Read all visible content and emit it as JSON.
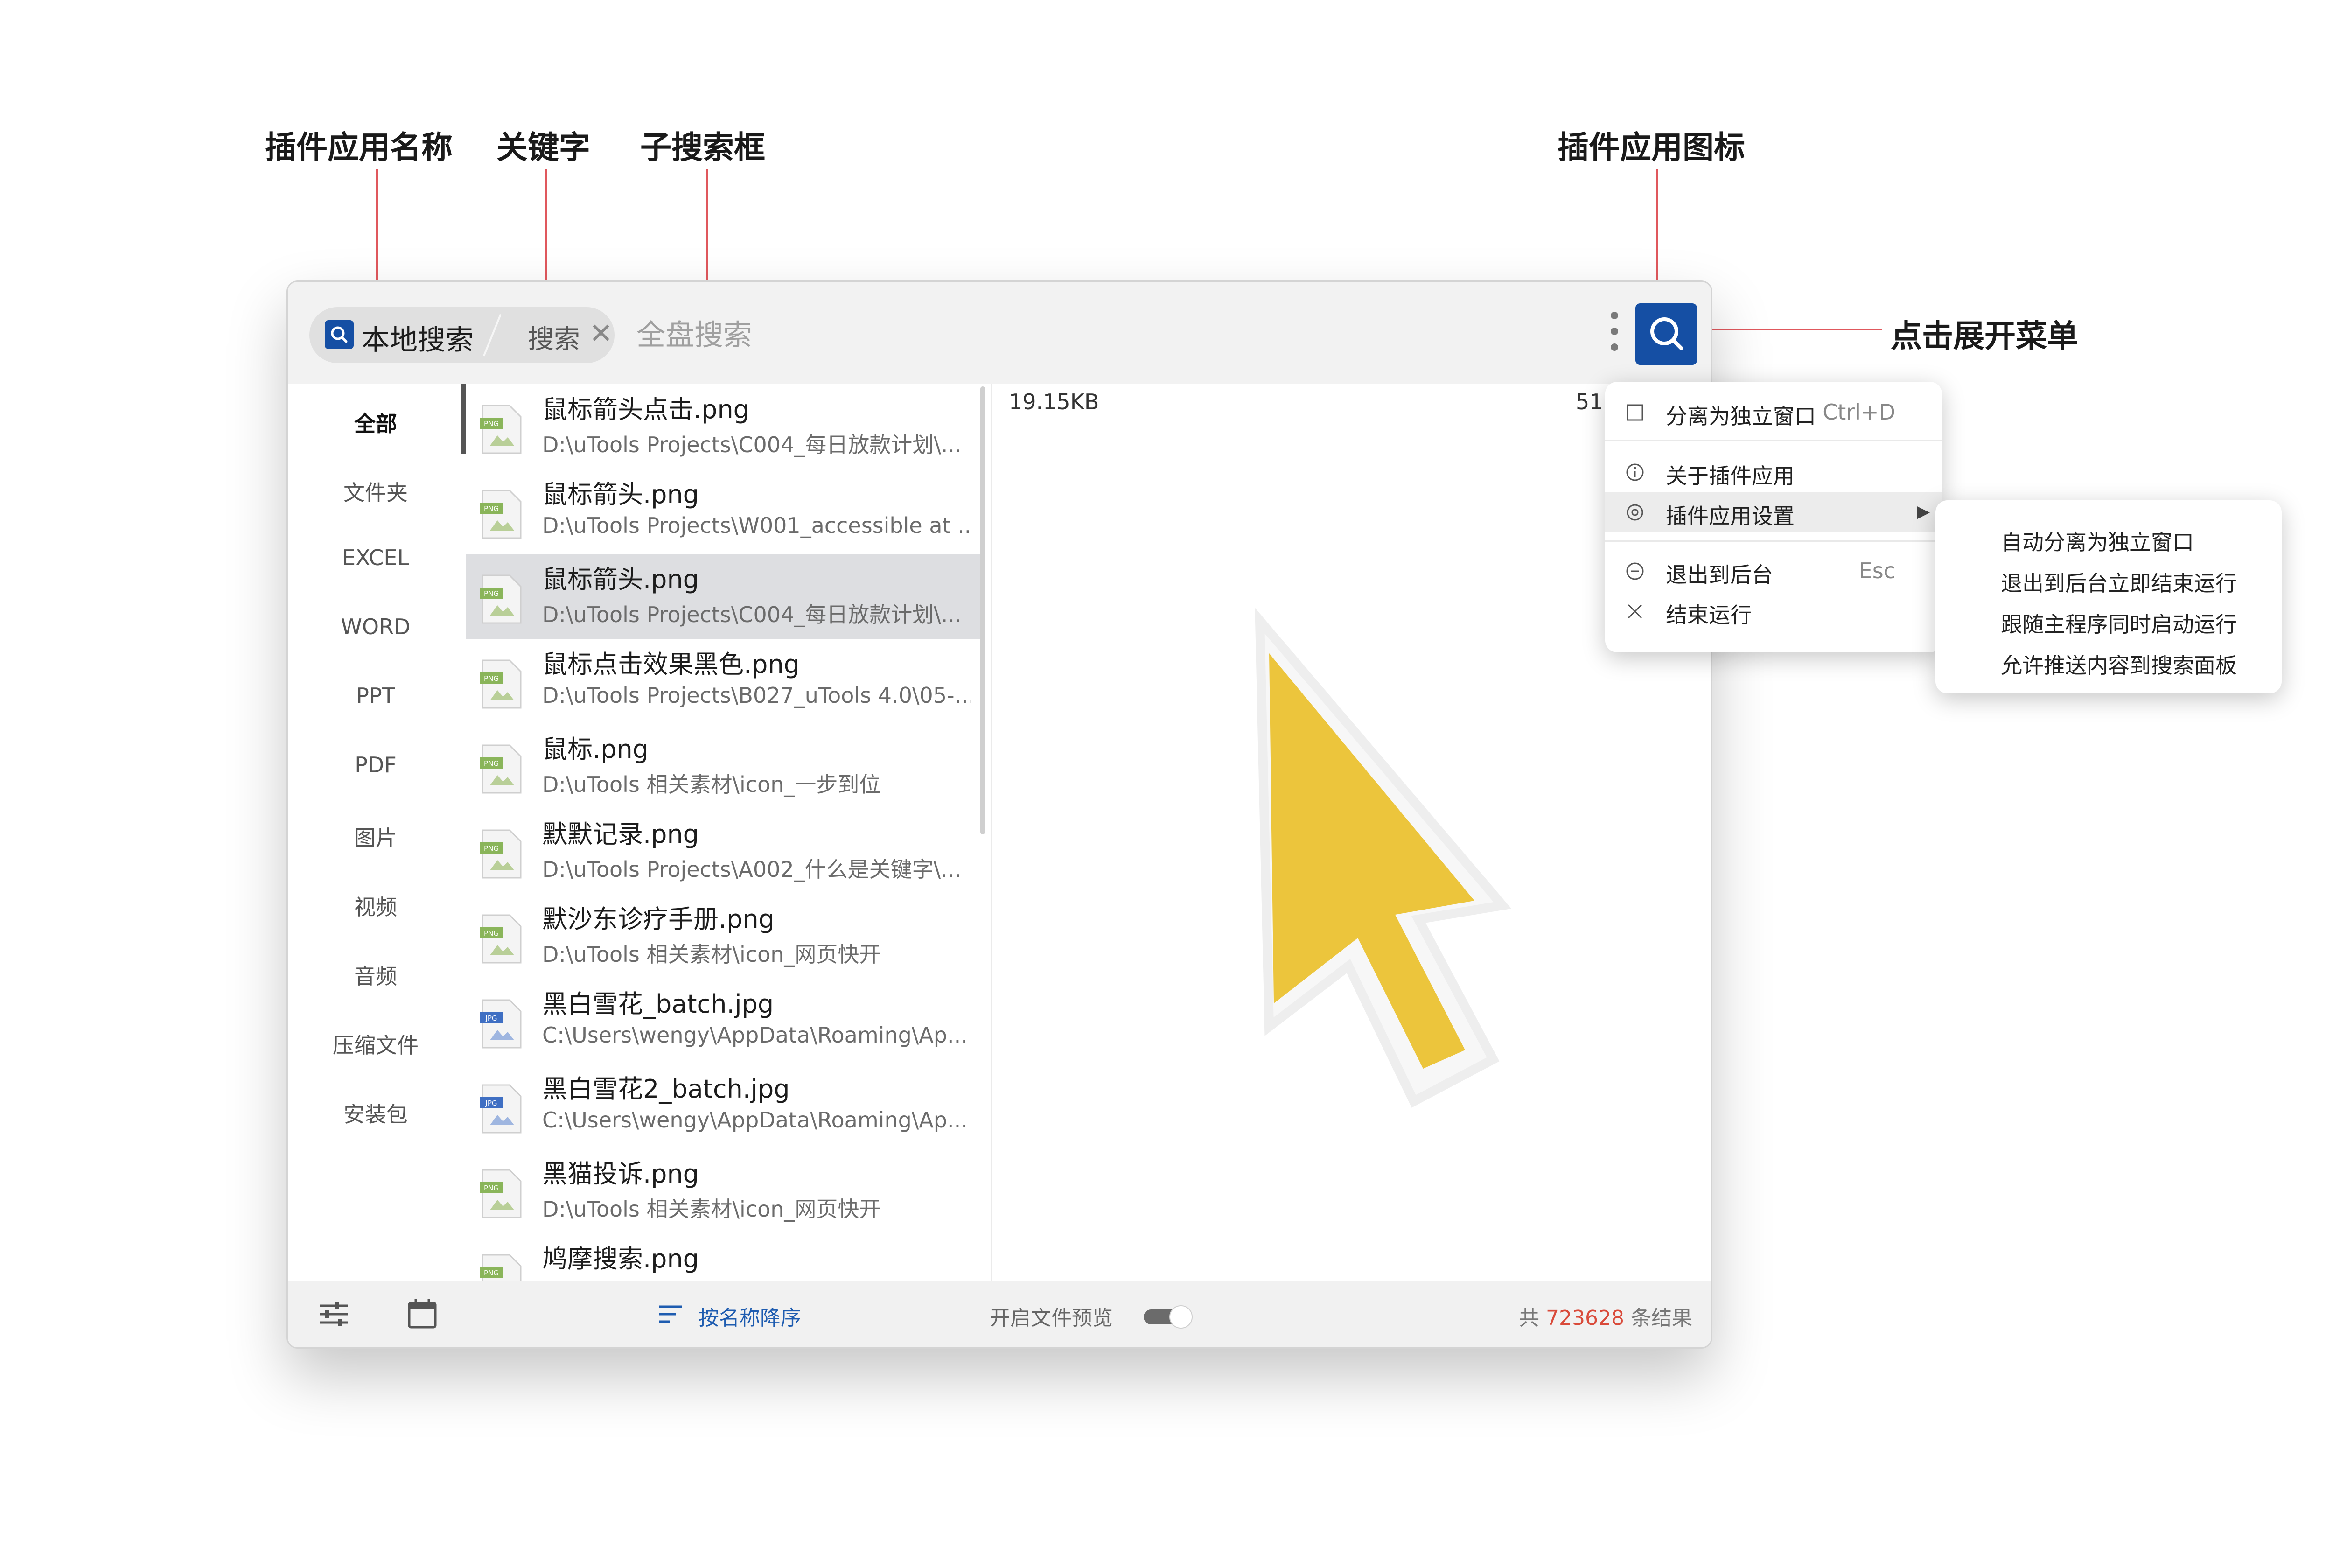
{
  "callouts": {
    "plugin_name": "插件应用名称",
    "keyword": "关键字",
    "sub_search": "子搜索框",
    "plugin_icon": "插件应用图标",
    "click_menu": "点击展开菜单"
  },
  "search_bar": {
    "app_name": "本地搜索",
    "keyword_tag": "搜索",
    "keyword_close": "✕",
    "placeholder": "全盘搜索"
  },
  "sidebar": {
    "items": [
      {
        "label": "全部",
        "active": true
      },
      {
        "label": "文件夹"
      },
      {
        "label": "EXCEL"
      },
      {
        "label": "WORD"
      },
      {
        "label": "PPT"
      },
      {
        "label": "PDF"
      },
      {
        "label": "图片"
      },
      {
        "label": "视频"
      },
      {
        "label": "音频"
      },
      {
        "label": "压缩文件"
      },
      {
        "label": "安装包"
      }
    ]
  },
  "files": [
    {
      "name": "鼠标箭头点击.png",
      "path": "D:\\uTools Projects\\C004_每日放款计划\\...",
      "type": "PNG"
    },
    {
      "name": "鼠标箭头.png",
      "path": "D:\\uTools Projects\\W001_accessible at ...",
      "type": "PNG"
    },
    {
      "name": "鼠标箭头.png",
      "path": "D:\\uTools Projects\\C004_每日放款计划\\...",
      "type": "PNG",
      "selected": true
    },
    {
      "name": "鼠标点击效果黑色.png",
      "path": "D:\\uTools Projects\\B027_uTools 4.0\\05-...",
      "type": "PNG"
    },
    {
      "name": "鼠标.png",
      "path": "D:\\uTools 相关素材\\icon_一步到位",
      "type": "PNG"
    },
    {
      "name": "默默记录.png",
      "path": "D:\\uTools Projects\\A002_什么是关键字\\...",
      "type": "PNG"
    },
    {
      "name": "默沙东诊疗手册.png",
      "path": "D:\\uTools 相关素材\\icon_网页快开",
      "type": "PNG"
    },
    {
      "name": "黑白雪花_batch.jpg",
      "path": "C:\\Users\\wengy\\AppData\\Roaming\\Ap...",
      "type": "JPG"
    },
    {
      "name": "黑白雪花2_batch.jpg",
      "path": "C:\\Users\\wengy\\AppData\\Roaming\\Ap...",
      "type": "JPG"
    },
    {
      "name": "黑猫投诉.png",
      "path": "D:\\uTools 相关素材\\icon_网页快开",
      "type": "PNG"
    },
    {
      "name": "鸠摩搜索.png",
      "path": "",
      "type": "PNG"
    }
  ],
  "preview": {
    "size": "19.15KB",
    "right_text": "51"
  },
  "footer": {
    "sort_label": "按名称降序",
    "preview_label": "开启文件预览",
    "count_prefix": "共",
    "count": "723628",
    "count_suffix": "条结果"
  },
  "menu": {
    "items": [
      {
        "label": "分离为独立窗口",
        "shortcut": "Ctrl+D",
        "icon": "square-icon"
      },
      {
        "label": "关于插件应用",
        "icon": "info-icon"
      },
      {
        "label": "插件应用设置",
        "icon": "gear-icon",
        "highlighted": true,
        "has_submenu": true
      },
      {
        "label": "退出到后台",
        "shortcut": "Esc",
        "icon": "minus-circle-icon"
      },
      {
        "label": "结束运行",
        "icon": "close-icon"
      }
    ],
    "submenu_arrow": "▶"
  },
  "submenu": {
    "items": [
      {
        "label": "自动分离为独立窗口"
      },
      {
        "label": "退出到后台立即结束运行"
      },
      {
        "label": "跟随主程序同时启动运行"
      },
      {
        "label": "允许推送内容到搜索面板"
      }
    ]
  },
  "colors": {
    "accent": "#154fa4",
    "callout_line": "#e0585d",
    "count_number": "#d94a3a",
    "cursor_fill": "#ecc53c",
    "selected_row": "#dddee1"
  }
}
